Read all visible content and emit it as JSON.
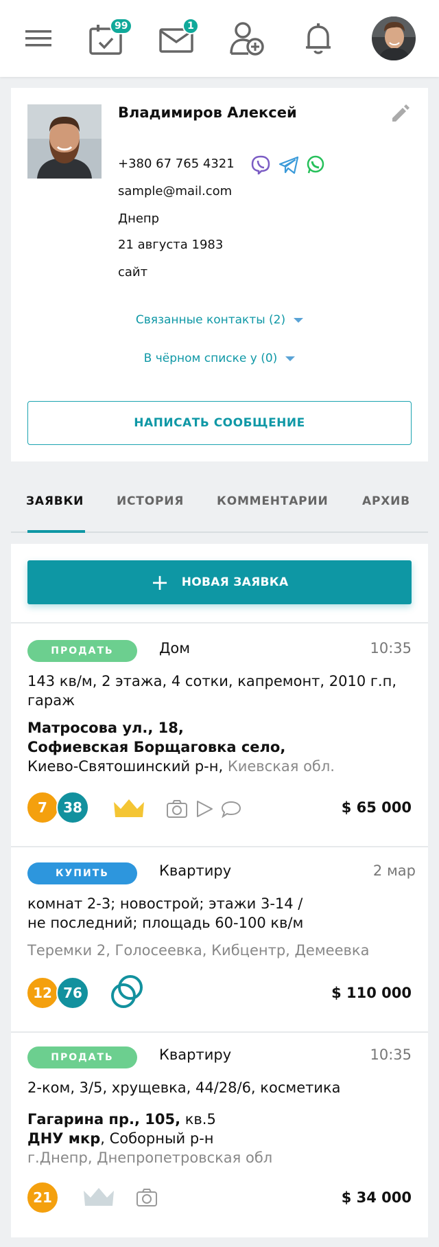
{
  "topbar": {
    "menu_icon": "hamburger-icon",
    "calendar_icon": "calendar-check-icon",
    "calendar_badge": "99",
    "mail_icon": "envelope-icon",
    "mail_badge": "1",
    "add_contact_icon": "user-plus-icon",
    "notifications_icon": "bell-icon",
    "avatar_icon": "user-avatar"
  },
  "profile": {
    "name": "Владимиров Алексей",
    "phone": "+380 67 765 4321",
    "email": "sample@mail.com",
    "city": "Днепр",
    "birthday": "21 августа 1983",
    "site": "сайт",
    "related_contacts": "Связанные контакты (2)",
    "blacklist": "В чёрном списке у (0)",
    "write_button": "НАПИСАТЬ СООБЩЕНИЕ",
    "messengers": [
      "viber-icon",
      "telegram-icon",
      "whatsapp-icon"
    ]
  },
  "tabs": [
    {
      "label": "ЗАЯВКИ",
      "active": true
    },
    {
      "label": "ИСТОРИЯ",
      "active": false
    },
    {
      "label": "КОММЕНТАРИИ",
      "active": false
    },
    {
      "label": "АРХИВ",
      "active": false
    }
  ],
  "new_request_button": "НОВАЯ ЗАЯВКА",
  "requests": [
    {
      "tag": "ПРОДАТЬ",
      "type": "Дом",
      "time": "10:35",
      "description": "143 кв/м, 2 этажа, 4 сотки, капремонт, 2010 г.п, гараж",
      "address_bold_1": "Матросова ул., 18,",
      "address_bold_2": "Софиевская Борщаговка село,",
      "address_district": "Киево-Святошинский р-н,",
      "address_region": "Киевская обл.",
      "count_1": "7",
      "count_2": "38",
      "price": "$ 65 000"
    },
    {
      "tag": "КУПИТЬ",
      "type": "Квартиру",
      "time": "2 мар",
      "description_1": "комнат 2-3; новострой; этажи 3-14 /",
      "description_2": "не последний; площадь 60-100 кв/м",
      "locations": "Теремки 2, Голосеевка, Кибцентр, Демеевка",
      "count_1": "12",
      "count_2": "76",
      "price": "$ 110 000"
    },
    {
      "tag": "ПРОДАТЬ",
      "type": "Квартиру",
      "time": "10:35",
      "description": "2-ком, 3/5, хрущевка, 44/28/6, косметика",
      "address_bold_1": "Гагарина пр., 105,",
      "address_rest_1": "кв.5",
      "address_bold_2": "ДНУ мкр",
      "address_rest_2": ", Соборный р-н",
      "address_region": "г.Днепр, Днепропетровская обл",
      "count_1": "21",
      "price": "$ 34 000"
    }
  ]
}
